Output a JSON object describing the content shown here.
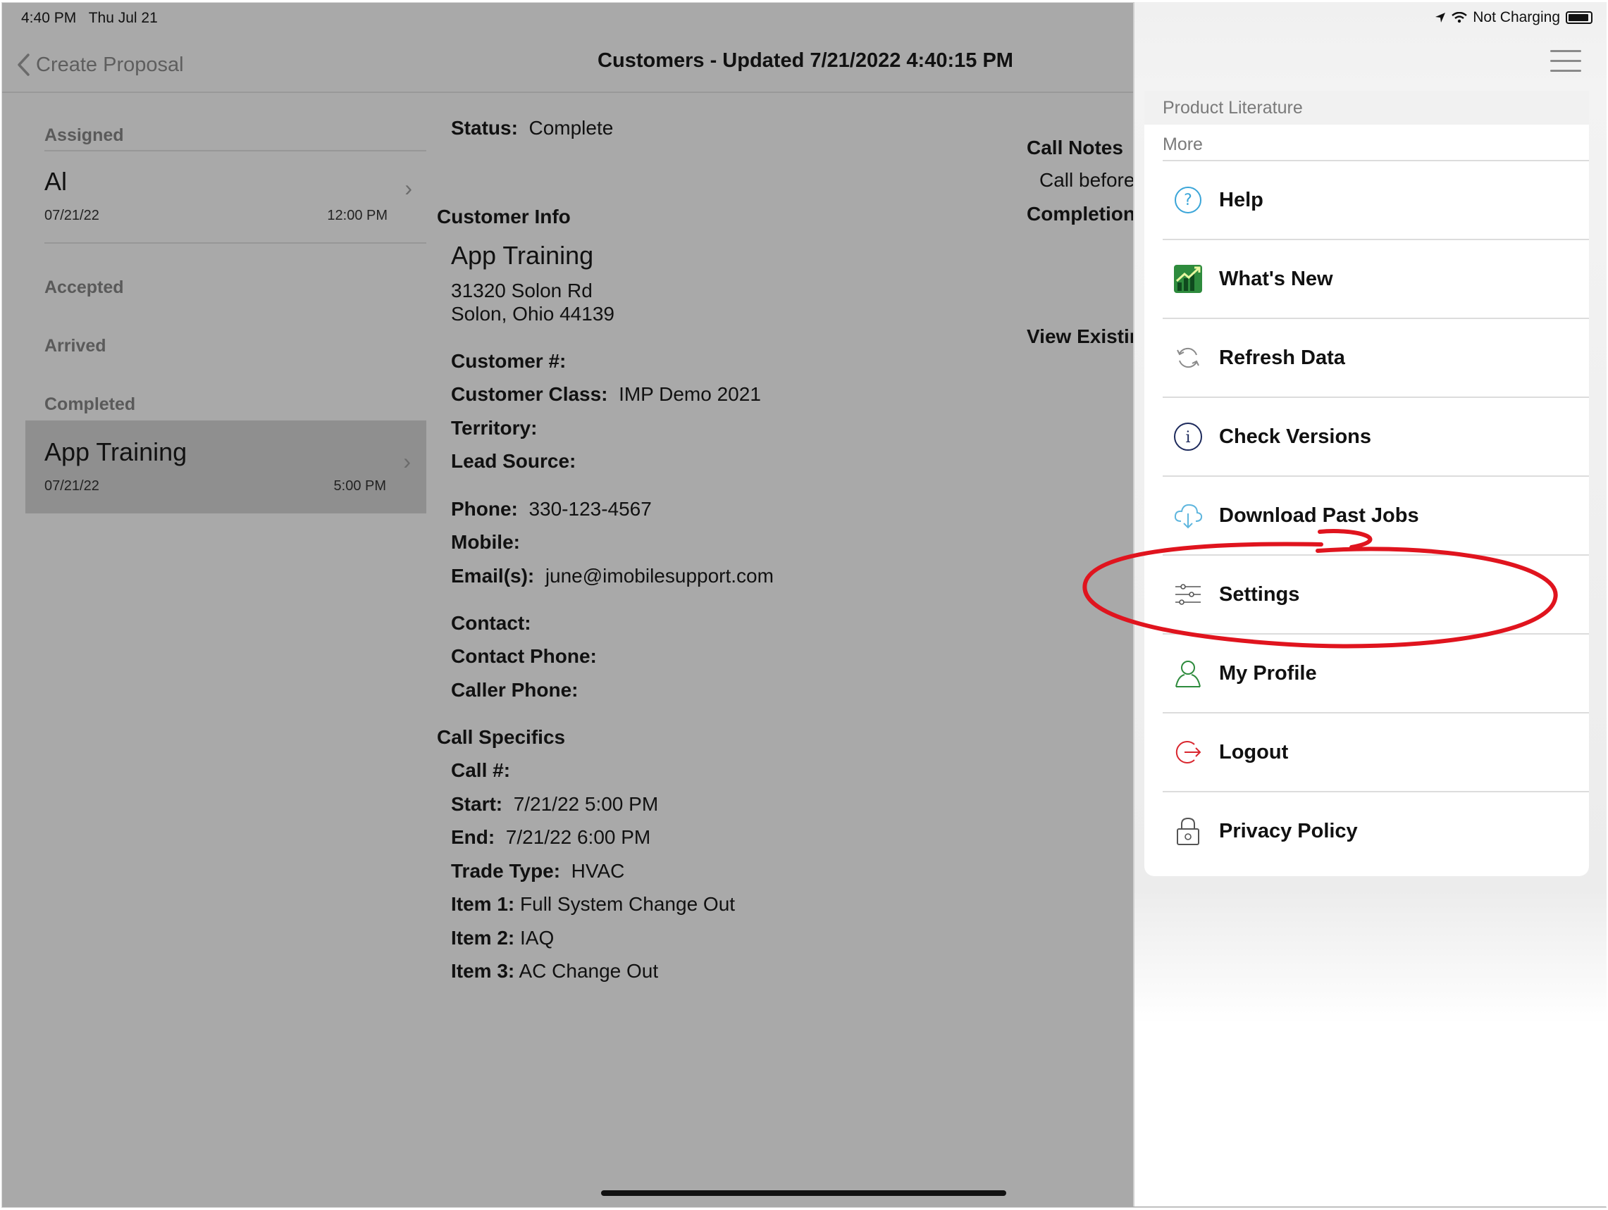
{
  "status_bar": {
    "time": "4:40 PM",
    "date": "Thu Jul 21",
    "charging": "Not Charging"
  },
  "nav": {
    "back_label": "Create Proposal",
    "title": "Customers - Updated 7/21/2022 4:40:15 PM"
  },
  "list": {
    "assigned_header": "Assigned",
    "assigned_item": {
      "title": "Al",
      "date": "07/21/22",
      "time": "12:00 PM"
    },
    "accepted_header": "Accepted",
    "arrived_header": "Arrived",
    "completed_header": "Completed",
    "completed_item": {
      "title": "App Training",
      "date": "07/21/22",
      "time": "5:00 PM"
    }
  },
  "detail": {
    "status_label": "Status:",
    "status_value": "Complete",
    "customer_info_title": "Customer Info",
    "customer_name": "App Training",
    "address_line1": "31320 Solon Rd",
    "address_line2": "Solon, Ohio 44139",
    "customer_no_label": "Customer #:",
    "customer_class_label": "Customer Class:",
    "customer_class_value": "IMP Demo 2021",
    "territory_label": "Territory:",
    "lead_source_label": "Lead Source:",
    "phone_label": "Phone:",
    "phone_value": "330-123-4567",
    "mobile_label": "Mobile:",
    "email_label": "Email(s):",
    "email_value": "june@imobilesupport.com",
    "contact_label": "Contact:",
    "contact_phone_label": "Contact Phone:",
    "caller_phone_label": "Caller Phone:",
    "call_specifics_title": "Call Specifics",
    "call_no_label": "Call #:",
    "start_label": "Start:",
    "start_value": "7/21/22 5:00 PM",
    "end_label": "End:",
    "end_value": "7/21/22 6:00 PM",
    "trade_type_label": "Trade Type:",
    "trade_type_value": "HVAC",
    "item1_label": "Item 1:",
    "item1_value": "Full System Change Out",
    "item2_label": "Item 2:",
    "item2_value": "IAQ",
    "item3_label": "Item 3:",
    "item3_value": "AC Change Out"
  },
  "notes": {
    "call_notes_title": "Call Notes",
    "call_notes_text": "Call before a",
    "completion_label": "Completion I",
    "view_existing": "View Existing"
  },
  "menu": {
    "header_product": "Product Literature",
    "header_more": "More",
    "items": [
      {
        "label": "Help",
        "icon": "help-icon"
      },
      {
        "label": "What's New",
        "icon": "whats-new-icon"
      },
      {
        "label": "Refresh Data",
        "icon": "refresh-icon"
      },
      {
        "label": "Check Versions",
        "icon": "info-icon"
      },
      {
        "label": "Download Past Jobs",
        "icon": "cloud-download-icon"
      },
      {
        "label": "Settings",
        "icon": "sliders-icon"
      },
      {
        "label": "My Profile",
        "icon": "person-icon"
      },
      {
        "label": "Logout",
        "icon": "logout-icon"
      },
      {
        "label": "Privacy Policy",
        "icon": "lock-icon"
      }
    ]
  },
  "colors": {
    "annotation_red": "#e0141e",
    "icon_green": "#2e8b3d",
    "icon_blue": "#3aa5d8",
    "logout_red": "#d9262e"
  }
}
